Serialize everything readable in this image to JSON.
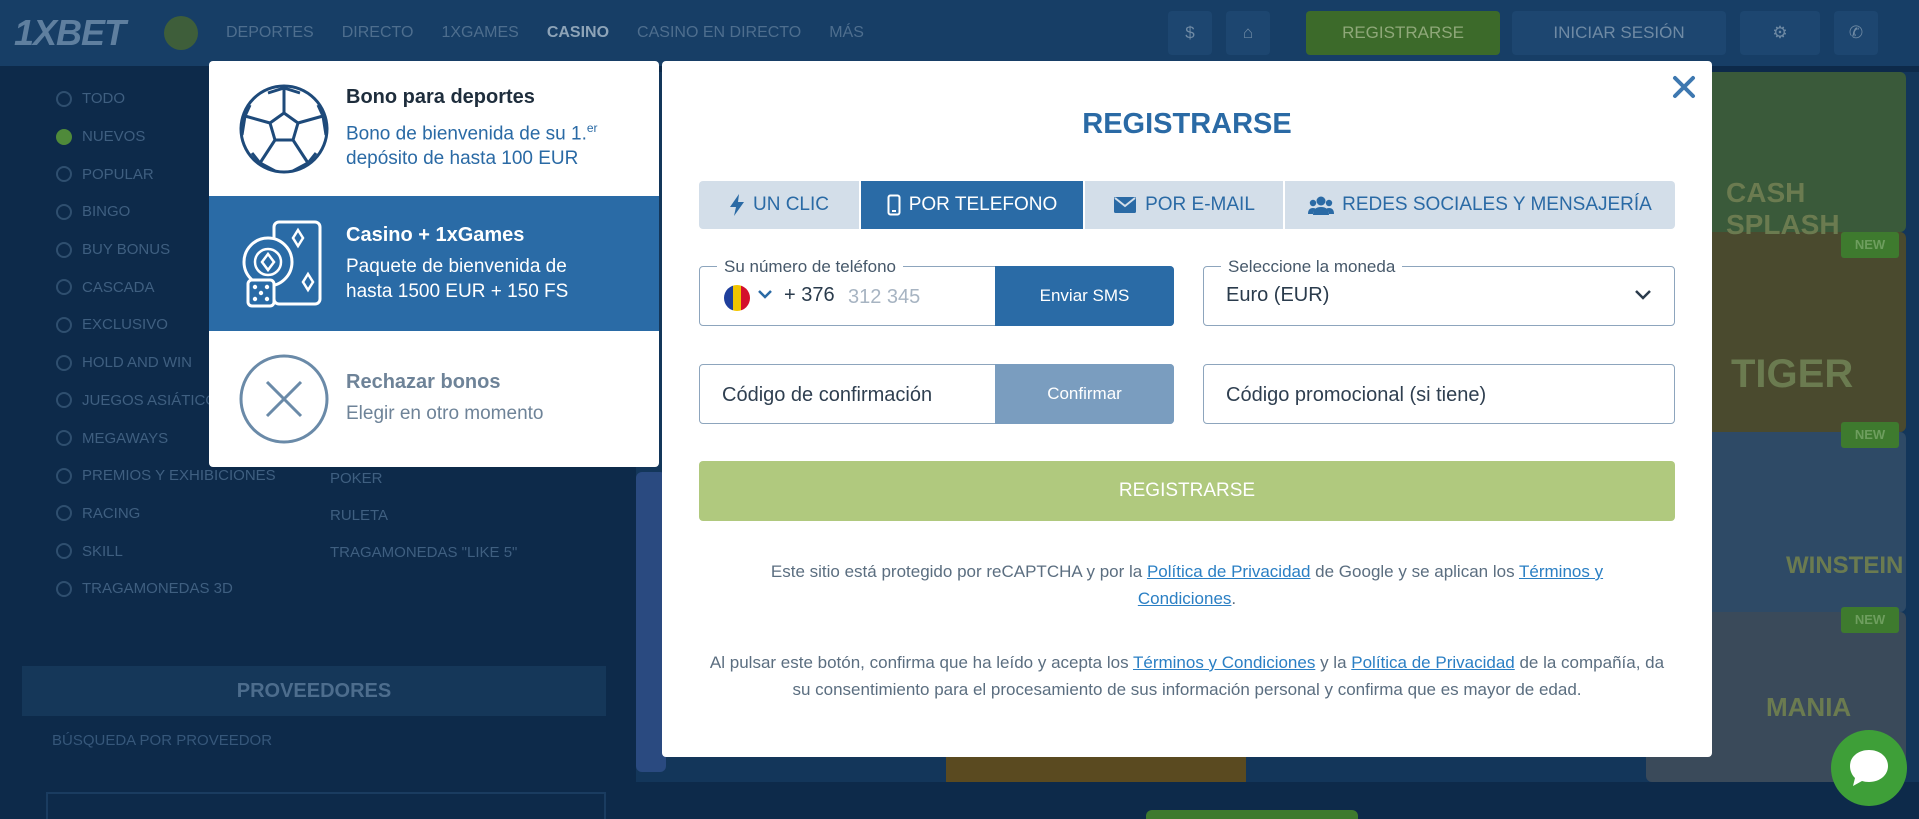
{
  "background": {
    "logo": "1XBET",
    "nav": [
      "DEPORTES",
      "DIRECTO",
      "1XGAMES",
      "CASINO",
      "CASINO EN DIRECTO",
      "MÁS"
    ],
    "nav_active": "CASINO",
    "header_register": "REGISTRARSE",
    "header_login": "INICIAR SESIÓN",
    "sidebar_items": [
      "TODO",
      "NUEVOS",
      "POPULAR",
      "BINGO",
      "BUY BONUS",
      "CASCADA",
      "EXCLUSIVO",
      "HOLD AND WIN",
      "JUEGOS ASIÁTICOS",
      "MEGAWAYS",
      "PREMIOS Y EXHIBICIONES",
      "RACING",
      "SKILL",
      "TRAGAMONEDAS 3D"
    ],
    "sidebar_active": 1,
    "sidebar2_items": [
      "POKER",
      "RULETA",
      "TRAGAMONEDAS \"LIKE 5\""
    ],
    "providers_title": "PROVEEDORES",
    "providers_search": "BÚSQUEDA POR PROVEEDOR",
    "tile_labels": [
      "CASH SPLASH",
      "TIGER",
      "WINSTEIN",
      "MANIA"
    ],
    "new_badge": "NEW"
  },
  "bonus_panel": {
    "options": [
      {
        "title": "Bono para deportes",
        "desc_pre": "Bono de bienvenida de su 1.",
        "desc_sup": "er",
        "desc_post": "depósito de hasta 100 EUR"
      },
      {
        "title": "Casino + 1xGames",
        "desc_line1": "Paquete de bienvenida de",
        "desc_line2": "hasta 1500 EUR + 150 FS"
      },
      {
        "title": "Rechazar bonos",
        "desc": "Elegir en otro momento"
      }
    ],
    "selected_index": 1
  },
  "modal": {
    "title": "REGISTRARSE",
    "tabs": [
      {
        "label": "UN CLIC",
        "icon": "lightning-icon"
      },
      {
        "label": "POR TELEFONO",
        "icon": "phone-icon"
      },
      {
        "label": "POR E-MAIL",
        "icon": "envelope-icon"
      },
      {
        "label": "REDES SOCIALES Y MENSAJERÍA",
        "icon": "users-icon"
      }
    ],
    "active_tab": 1,
    "phone": {
      "legend": "Su número de teléfono",
      "country_code": "+ 376",
      "placeholder": "312 345",
      "flag": "andorra-flag-icon",
      "send_sms": "Enviar SMS"
    },
    "currency": {
      "legend": "Seleccione la moneda",
      "value": "Euro (EUR)"
    },
    "confirmation": {
      "placeholder": "Código de confirmación",
      "button": "Confirmar"
    },
    "promo": {
      "placeholder": "Código promocional (si tiene)"
    },
    "register_button": "REGISTRARSE",
    "recaptcha": {
      "pre": "Este sitio está protegido por reCAPTCHA y por la ",
      "privacy": "Política de Privacidad",
      "mid": " de Google y se aplican los ",
      "terms": "Términos y Condiciones",
      "post": "."
    },
    "consent": {
      "pre": "Al pulsar este botón, confirma que ha leído y acepta los ",
      "terms": "Términos y Condiciones",
      "mid": " y la ",
      "privacy": "Política de Privacidad",
      "post": " de la compañía, da su consentimiento para el procesamiento de sus información personal y confirma que es mayor de edad."
    }
  },
  "colors": {
    "primary": "#2a6ba6",
    "register_green": "#b0c97e",
    "confirm_muted": "#7a9dbf",
    "tab_inactive": "#d3dee9",
    "chat_green": "#3e9f38"
  }
}
